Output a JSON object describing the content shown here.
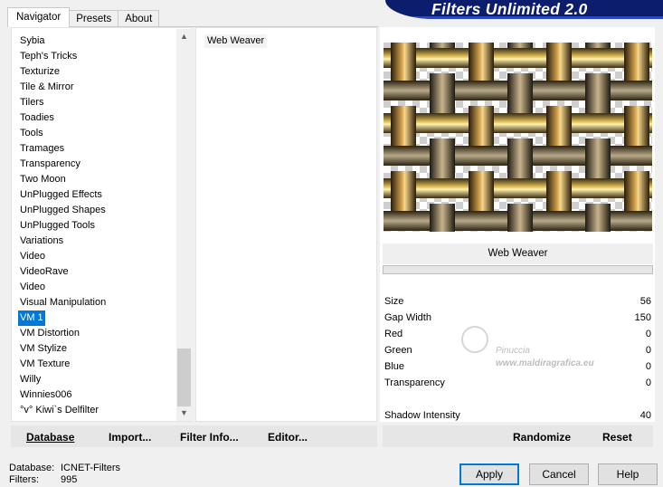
{
  "tabs": [
    "Navigator",
    "Presets",
    "About"
  ],
  "banner_title": "Filters Unlimited 2.0",
  "categories": [
    "Sybia",
    "Teph's Tricks",
    "Texturize",
    "Tile & Mirror",
    "Tilers",
    "Toadies",
    "Tools",
    "Tramages",
    "Transparency",
    "Two Moon",
    "UnPlugged Effects",
    "UnPlugged Shapes",
    "UnPlugged Tools",
    "Variations",
    "Video",
    "VideoRave",
    "Video",
    "Visual Manipulation",
    "VM 1",
    "VM Distortion",
    "VM Stylize",
    "VM Texture",
    "Willy",
    "Winnies006",
    "°v° Kiwi`s Delfilter"
  ],
  "selected_category": "VM 1",
  "filters": [
    "Web Weaver"
  ],
  "filter_name": "Web Weaver",
  "params": [
    {
      "label": "Size",
      "value": "56"
    },
    {
      "label": "Gap Width",
      "value": "150"
    },
    {
      "label": "Red",
      "value": "0"
    },
    {
      "label": "Green",
      "value": "0"
    },
    {
      "label": "Blue",
      "value": "0"
    },
    {
      "label": "Transparency",
      "value": "0"
    },
    {
      "label": "Shadow Intensity",
      "value": "40"
    }
  ],
  "watermark": {
    "line1": "Pinuccia",
    "line2": "www.maldiragrafica.eu"
  },
  "left_buttons": {
    "database": "Database",
    "import": "Import...",
    "filter_info": "Filter Info...",
    "editor": "Editor..."
  },
  "right_buttons": {
    "randomize": "Randomize",
    "reset": "Reset"
  },
  "status": {
    "database_label": "Database:",
    "database_value": "ICNET-Filters",
    "filters_label": "Filters:",
    "filters_value": "995"
  },
  "dialog_buttons": {
    "apply": "Apply",
    "cancel": "Cancel",
    "help": "Help"
  },
  "colors": {
    "banner": "#0c1d6e",
    "selection": "#0078d7",
    "default_button_border": "#0078d7"
  }
}
